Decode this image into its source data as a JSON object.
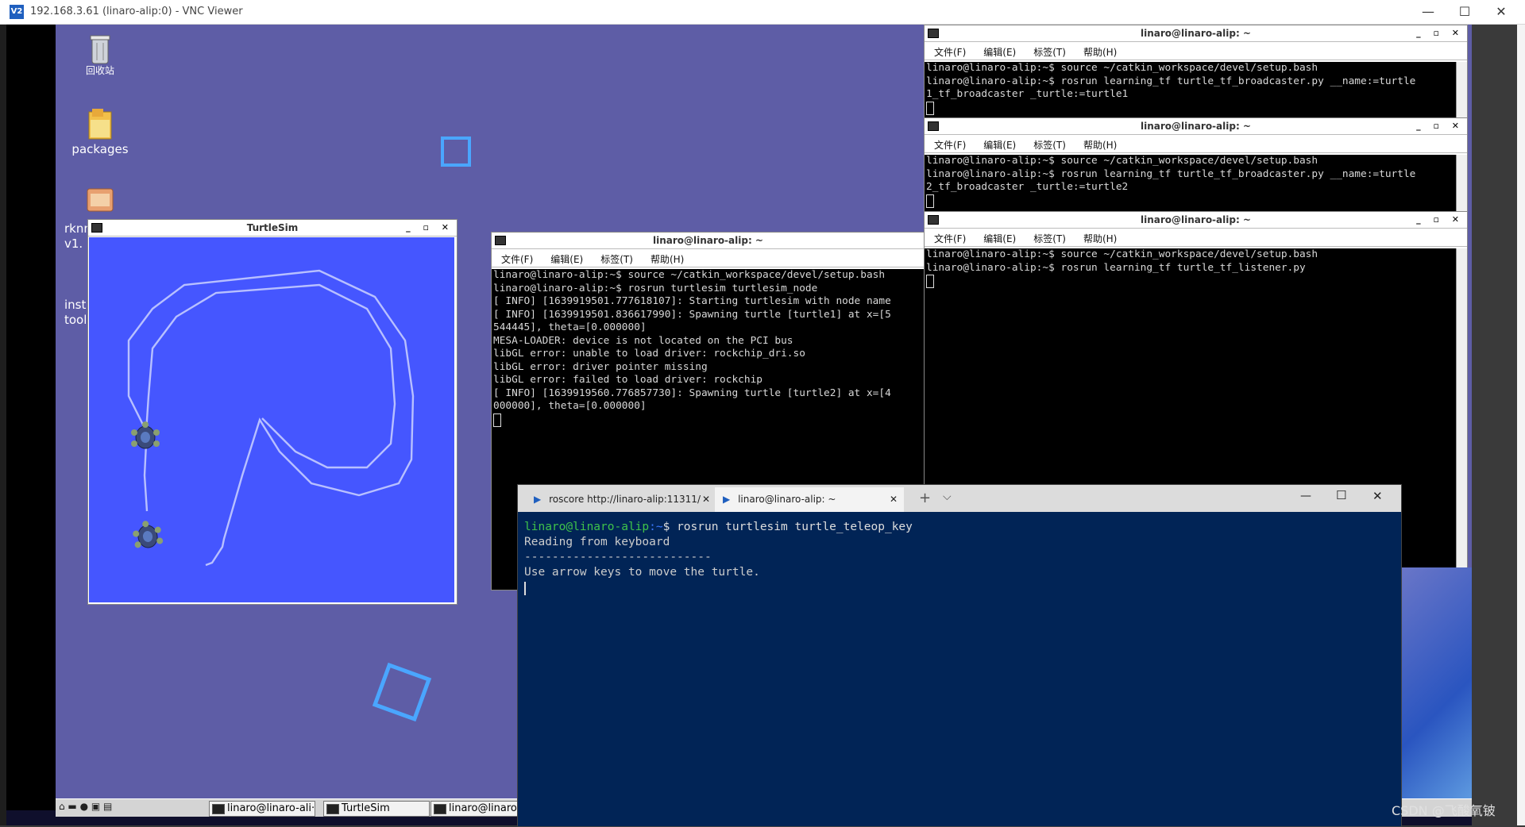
{
  "vnc": {
    "title": "192.168.3.61 (linaro-alip:0) - VNC Viewer",
    "icon": "V2",
    "controls": [
      "—",
      "☐",
      "✕"
    ]
  },
  "desktop": {
    "icons": [
      {
        "label": "回收站",
        "icon": "trash-icon"
      },
      {
        "label": "packages",
        "icon": "folder-icon"
      },
      {
        "label": "rknn v1.",
        "icon": "archive-icon"
      },
      {
        "label": "inst tool",
        "icon": "installer-icon"
      }
    ]
  },
  "turtlesim": {
    "title": "TurtleSim",
    "controls": "_ ▫ ✕",
    "background": "#4556ff"
  },
  "terminal_main": {
    "title": "linaro@linaro-alip: ~",
    "menu": [
      "文件(F)",
      "编辑(E)",
      "标签(T)",
      "帮助(H)"
    ],
    "lines": [
      "linaro@linaro-alip:~$ source ~/catkin_workspace/devel/setup.bash",
      "linaro@linaro-alip:~$ rosrun turtlesim turtlesim_node",
      "[ INFO] [1639919501.777618107]: Starting turtlesim with node name",
      "[ INFO] [1639919501.836617990]: Spawning turtle [turtle1] at x=[5",
      "544445], theta=[0.000000]",
      "MESA-LOADER: device is not located on the PCI bus",
      "libGL error: unable to load driver: rockchip_dri.so",
      "libGL error: driver pointer missing",
      "libGL error: failed to load driver: rockchip",
      "[ INFO] [1639919560.776857730]: Spawning turtle [turtle2] at x=[4",
      "000000], theta=[0.000000]"
    ]
  },
  "terminal_broadcaster1": {
    "title": "linaro@linaro-alip: ~",
    "menu": [
      "文件(F)",
      "编辑(E)",
      "标签(T)",
      "帮助(H)"
    ],
    "lines": [
      "linaro@linaro-alip:~$ source ~/catkin_workspace/devel/setup.bash",
      "linaro@linaro-alip:~$ rosrun learning_tf turtle_tf_broadcaster.py __name:=turtle",
      "1_tf_broadcaster _turtle:=turtle1"
    ]
  },
  "terminal_broadcaster2": {
    "title": "linaro@linaro-alip: ~",
    "menu": [
      "文件(F)",
      "编辑(E)",
      "标签(T)",
      "帮助(H)"
    ],
    "lines": [
      "linaro@linaro-alip:~$ source ~/catkin_workspace/devel/setup.bash",
      "linaro@linaro-alip:~$ rosrun learning_tf turtle_tf_broadcaster.py __name:=turtle",
      "2_tf_broadcaster _turtle:=turtle2"
    ]
  },
  "terminal_listener": {
    "title": "linaro@linaro-alip: ~",
    "menu": [
      "文件(F)",
      "编辑(E)",
      "标签(T)",
      "帮助(H)"
    ],
    "lines": [
      "linaro@linaro-alip:~$ source ~/catkin_workspace/devel/setup.bash",
      "linaro@linaro-alip:~$ rosrun learning_tf turtle_tf_listener.py"
    ]
  },
  "windows_terminal": {
    "tabs": [
      {
        "label": "roscore http://linaro-alip:11311/",
        "active": false
      },
      {
        "label": "linaro@linaro-alip: ~",
        "active": true
      }
    ],
    "new_tab": "+",
    "dropdown": "⌵",
    "controls": [
      "—",
      "☐",
      "✕"
    ],
    "prompt_user": "linaro@linaro-alip",
    "prompt_path": ":~",
    "prompt_symbol": "$",
    "command": " rosrun turtlesim turtle_teleop_key",
    "output": [
      "Reading from keyboard",
      "---------------------------",
      "Use arrow keys to move the turtle."
    ]
  },
  "taskbar": {
    "items": [
      {
        "label": "linaro@linaro-ali···"
      },
      {
        "label": "TurtleSim"
      },
      {
        "label": "linaro@linaro-"
      }
    ]
  },
  "watermark": "CSDN @飞酸氧铍"
}
